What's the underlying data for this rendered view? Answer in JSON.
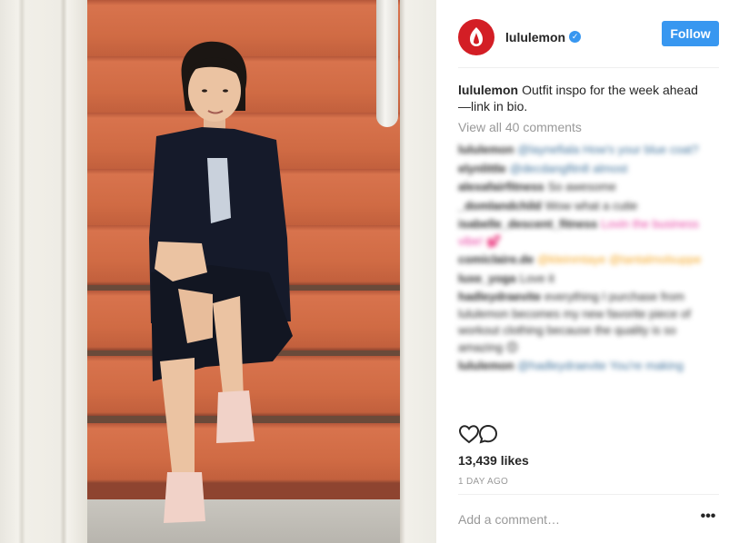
{
  "post": {
    "username": "lululemon",
    "follow_label": "Follow",
    "caption_user": "lululemon",
    "caption_text": "Outfit inspo for the week ahead —link in bio.",
    "view_all": "View all 40 comments",
    "likes": "13,439 likes",
    "time": "1 DAY AGO",
    "add_comment_placeholder": "Add a comment…",
    "more_label": "•••"
  },
  "comments": [
    {
      "user": "lululemon",
      "text": "@laynefiala How's your blue coat?"
    },
    {
      "user": "elynlittle",
      "text": "@decdangfitn8 almost"
    },
    {
      "user": "alexafairfitness",
      "text": "So awesome"
    },
    {
      "user": "_domlandchild",
      "text": "Wow what a cutie"
    },
    {
      "user": "isabelle_descent_fitness",
      "text": "Lovin the business vibe! 💕"
    },
    {
      "user": "comiclaire.de",
      "text": "@kleinmtaye @tantalmolsuppe"
    },
    {
      "user": "luxe_yoga",
      "text": "Love it"
    },
    {
      "user": "hadleydraevite",
      "text": "everything I purchase from lululemon becomes my new favorite piece of workout clothing because the quality is so amazing 😊"
    },
    {
      "user": "lululemon",
      "text": "@hadleydraevite You're making"
    }
  ],
  "colors": {
    "accent": "#3897f0",
    "brand_red": "#d31e25",
    "text": "#262626",
    "muted": "#999999"
  },
  "icons": {
    "like": "heart-icon",
    "comment": "comment-icon",
    "verified": "verified-badge-icon",
    "logo": "lululemon-logo-icon"
  }
}
